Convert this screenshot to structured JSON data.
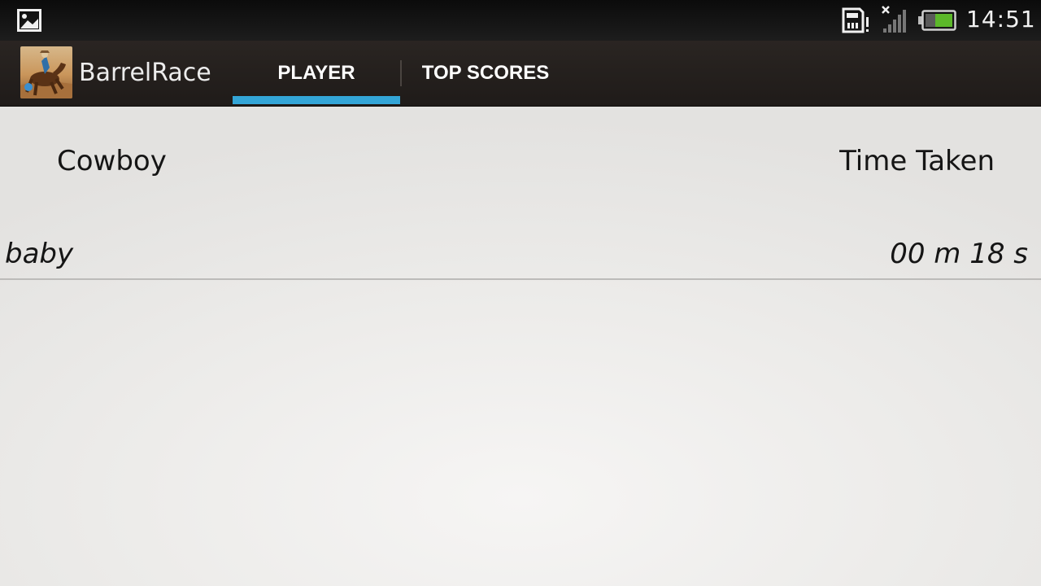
{
  "status_bar": {
    "icons": [
      "gallery-icon",
      "sd-card-icon",
      "signal-off-icon",
      "battery-icon"
    ],
    "time": "14:51",
    "battery_color": "#5cb82a"
  },
  "action_bar": {
    "app_title": "BarrelRace",
    "tabs": [
      {
        "label": "PLAYER",
        "selected": true
      },
      {
        "label": "TOP SCORES",
        "selected": false
      }
    ],
    "indicator_color": "#33a5d7"
  },
  "table": {
    "headers": [
      "Cowboy",
      "Time Taken"
    ],
    "rows": [
      {
        "cowboy": "baby",
        "time": "00 m 18 s"
      }
    ]
  }
}
